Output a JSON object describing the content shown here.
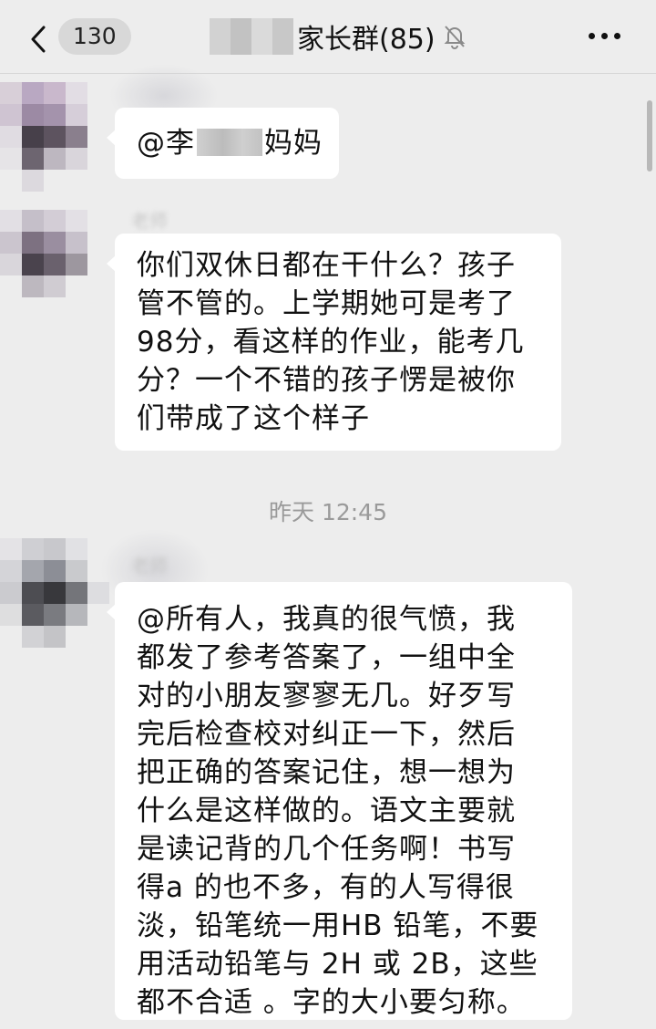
{
  "header": {
    "back_count": "130",
    "title": "家长群(85)",
    "icons": {
      "back": "chevron-left-icon",
      "mute": "bell-muted-icon",
      "more": "more-dots-icon"
    }
  },
  "messages": [
    {
      "sender": "",
      "lines": [
        {
          "before": "@李",
          "after": "妈妈"
        }
      ]
    },
    {
      "sender": "老师",
      "lines": [
        "你们双休日都在干什么？孩子",
        "管不管的。上学期她可是考了",
        "98分，看这样的作业，能考几",
        "分？一个不错的孩子愣是被你",
        "们带成了这个样子"
      ]
    },
    {
      "sender": "老师",
      "lines": [
        "@所有人，我真的很气愤，我",
        "都发了参考答案了，一组中全",
        "对的小朋友寥寥无几。好歹写",
        "完后检查校对纠正一下，然后",
        "把正确的答案记住，想一想为",
        "什么是这样做的。语文主要就",
        "是读记背的几个任务啊！书写",
        "得a 的也不多，有的人写得很",
        "淡，铅笔统一用HB 铅笔，不要",
        "用活动铅笔与 2H 或 2B，这些",
        "都不合适 。字的大小要匀称。"
      ]
    }
  ],
  "timestamp": "昨天 12:45",
  "colors": {
    "background": "#ededed",
    "bubble": "#ffffff",
    "timestamp": "#9a9a9a"
  }
}
